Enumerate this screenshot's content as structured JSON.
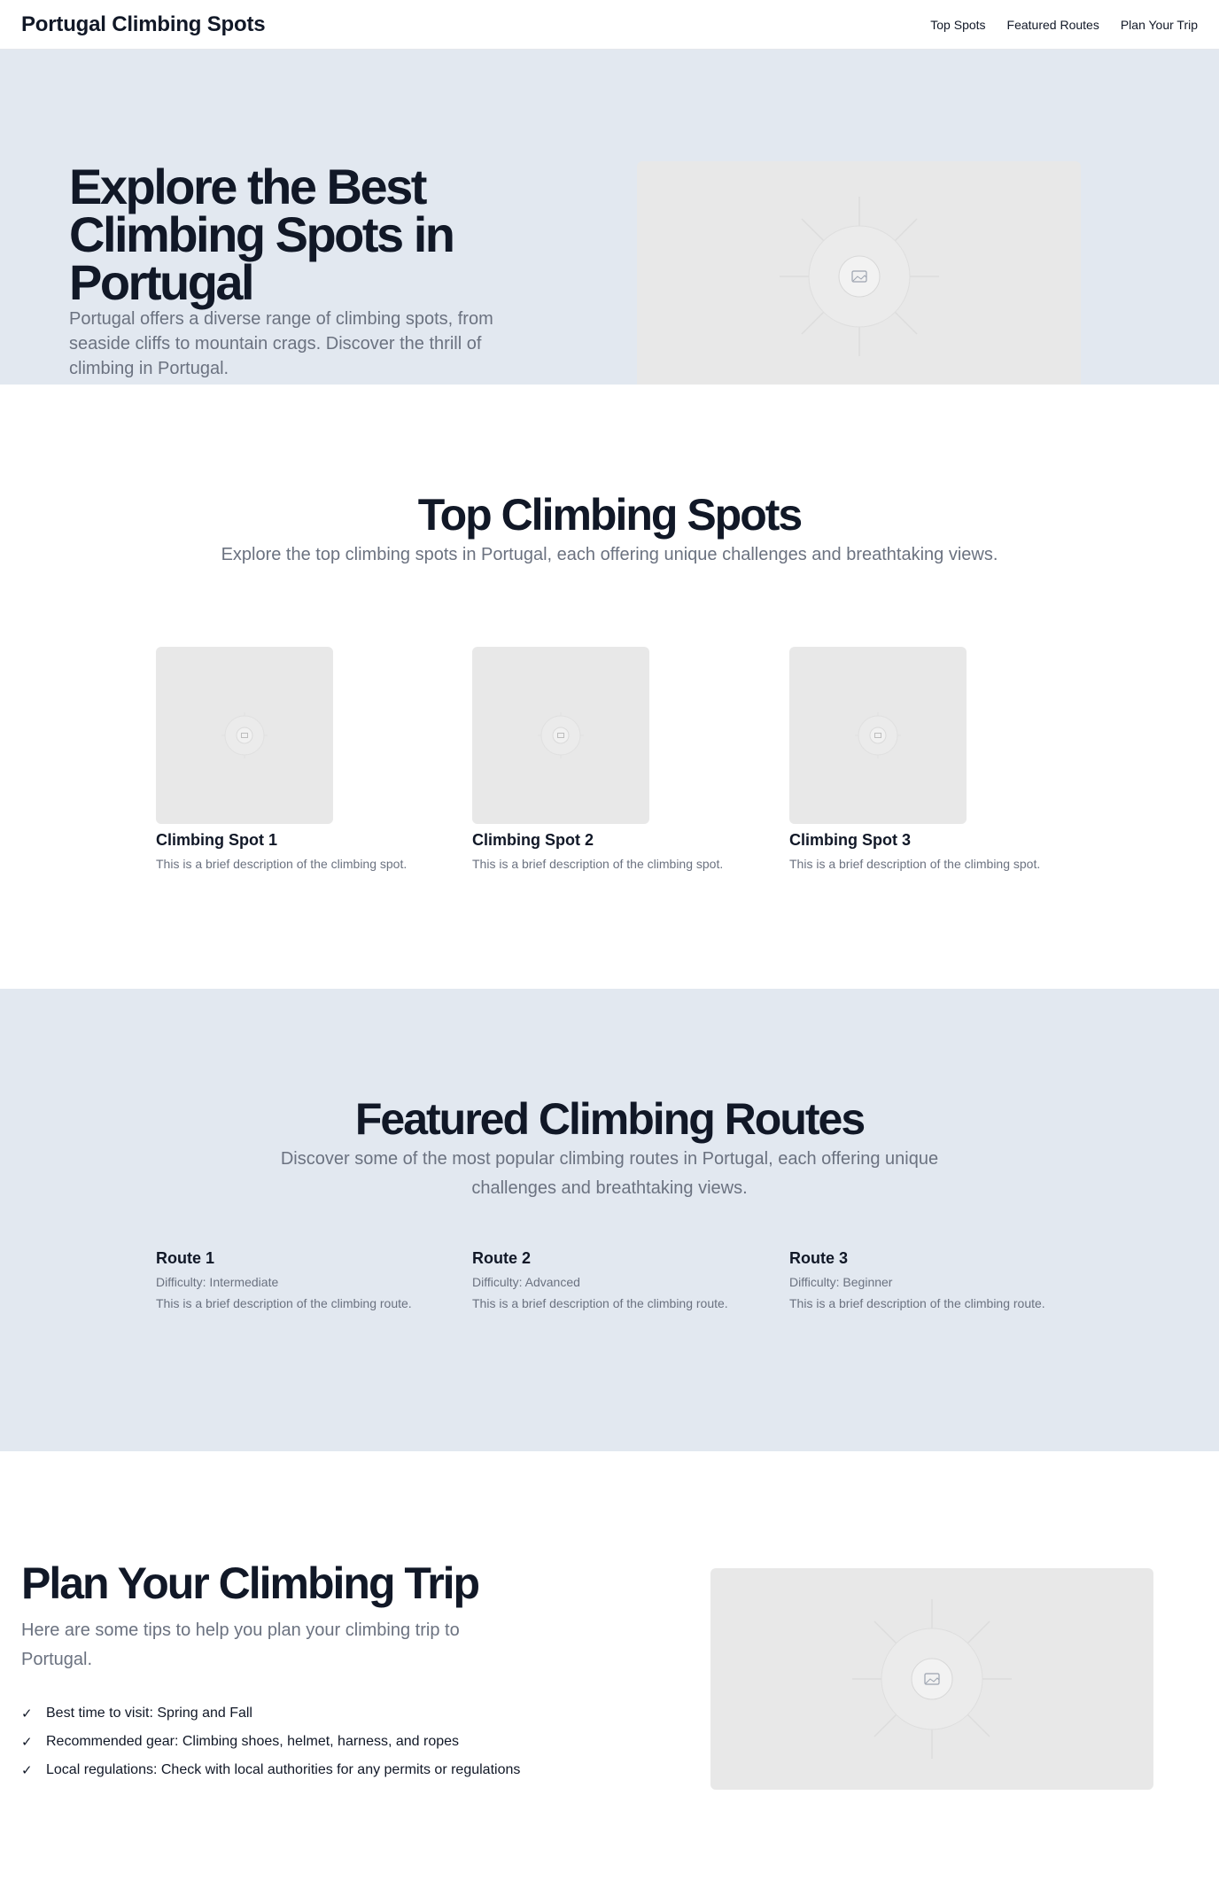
{
  "header": {
    "brand": "Portugal Climbing Spots",
    "nav": [
      "Top Spots",
      "Featured Routes",
      "Plan Your Trip"
    ]
  },
  "hero": {
    "title": "Explore the Best Climbing Spots in Portugal",
    "subtitle": "Portugal offers a diverse range of climbing spots, from seaside cliffs to mountain crags. Discover the thrill of climbing in Portugal.",
    "image_icon": "image-placeholder-icon"
  },
  "top_spots": {
    "title": "Top Climbing Spots",
    "subtitle": "Explore the top climbing spots in Portugal, each offering unique challenges and breathtaking views.",
    "cards": [
      {
        "name": "Climbing Spot 1",
        "desc": "This is a brief description of the climbing spot."
      },
      {
        "name": "Climbing Spot 2",
        "desc": "This is a brief description of the climbing spot."
      },
      {
        "name": "Climbing Spot 3",
        "desc": "This is a brief description of the climbing spot."
      }
    ]
  },
  "featured_routes": {
    "title": "Featured Climbing Routes",
    "subtitle": "Discover some of the most popular climbing routes in Portugal, each offering unique challenges and breathtaking views.",
    "routes": [
      {
        "name": "Route 1",
        "difficulty": "Difficulty: Intermediate",
        "desc": "This is a brief description of the climbing route."
      },
      {
        "name": "Route 2",
        "difficulty": "Difficulty: Advanced",
        "desc": "This is a brief description of the climbing route."
      },
      {
        "name": "Route 3",
        "difficulty": "Difficulty: Beginner",
        "desc": "This is a brief description of the climbing route."
      }
    ]
  },
  "plan": {
    "title": "Plan Your Climbing Trip",
    "subtitle": "Here are some tips to help you plan your climbing trip to Portugal.",
    "check_glyph": "✓",
    "tips": [
      "Best time to visit: Spring and Fall",
      "Recommended gear: Climbing shoes, helmet, harness, and ropes",
      "Local regulations: Check with local authorities for any permits or regulations"
    ]
  },
  "colors": {
    "section_bg": "#e2e8f0",
    "placeholder_bg": "#e8e8e8",
    "heading": "#111827",
    "muted": "#6b7280"
  }
}
